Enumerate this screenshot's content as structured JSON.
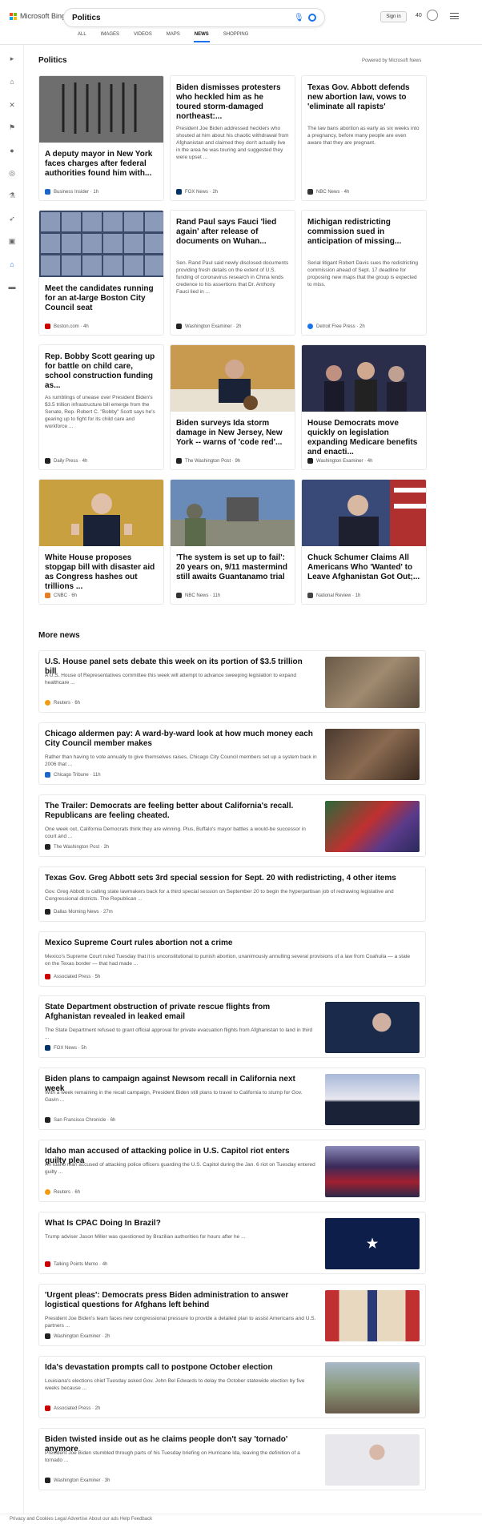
{
  "header": {
    "logo_text": "Microsoft Bing",
    "search_query": "Politics",
    "sign_in": "Sign in",
    "points": "40"
  },
  "tabs": [
    "ALL",
    "IMAGES",
    "VIDEOS",
    "MAPS",
    "NEWS",
    "SHOPPING"
  ],
  "active_tab": "NEWS",
  "sidebar_icons": [
    "expand-icon",
    "home-icon",
    "tools-icon",
    "flag-icon",
    "location-icon",
    "globe-icon",
    "science-icon",
    "rocket-icon",
    "film-icon",
    "bank-icon",
    "card-icon"
  ],
  "section": {
    "title": "Politics",
    "powered": "Powered by Microsoft News"
  },
  "cards": [
    {
      "title": "A deputy mayor in New York faces charges after federal authorities found him with...",
      "source": "Business Insider · 1h",
      "src_color": "#1a66cc",
      "img": "guns"
    },
    {
      "title": "Biden dismisses protesters who heckled him as he toured storm-damaged northeast:...",
      "snippet": "President Joe Biden addressed hecklers who shouted at him about his chaotic withdrawal from Afghanistan and claimed they don't actually live in the area he was touring and suggested they were upset ...",
      "source": "FOX News · 2h",
      "src_color": "#003366"
    },
    {
      "title": "Texas Gov. Abbott defends new abortion law, vows to 'eliminate all rapists'",
      "snippet": "The law bans abortion as early as six weeks into a pregnancy, before many people are even aware that they are pregnant.",
      "source": "NBC News · 4h",
      "src_color": "#333"
    },
    {
      "title": "Meet the candidates running for an at-large Boston City Council seat",
      "source": "Boston.com · 4h",
      "src_color": "#c00",
      "img": "grid"
    },
    {
      "title": "Rand Paul says Fauci 'lied again' after release of documents on Wuhan...",
      "snippet": "Sen. Rand Paul said newly disclosed documents providing fresh details on the extent of U.S. funding of coronavirus research in China lends credence to his assertions that Dr. Anthony Fauci lied in ...",
      "source": "Washington Examiner · 2h",
      "src_color": "#222"
    },
    {
      "title": "Michigan redistricting commission sued in anticipation of missing...",
      "snippet": "Serial litigant Robert Davis sues the redistricting commission ahead of Sept. 17 deadline for proposing new maps that the group is expected to miss.",
      "source": "Detroit Free Press · 2h",
      "src_color": "#1a73e8"
    },
    {
      "title": "Rep. Bobby Scott gearing up for battle on child care, school construction funding as...",
      "snippet": "As rumblings of unease over President Biden's $3.5 trillion infrastructure bill emerge from the Senate, Rep. Robert C. \"Bobby\" Scott says he's gearing up to fight for its child care and workforce ...",
      "source": "Daily Press · 4h",
      "src_color": "#222"
    },
    {
      "title": "Biden surveys Ida storm damage in New Jersey, New York -- warns of 'code red'...",
      "source": "The Washington Post · 9h",
      "src_color": "#222",
      "img": "biden"
    },
    {
      "title": "House Democrats move quickly on legislation expanding Medicare benefits and enacti...",
      "source": "Washington Examiner · 4h",
      "src_color": "#222",
      "img": "dems"
    },
    {
      "title": "White House proposes stopgap bill with disaster aid as Congress hashes out trillions ...",
      "source": "CNBC · 6h",
      "src_color": "#e67e22",
      "img": "biden2"
    },
    {
      "title": "'The system is set up to fail': 20 years on, 9/11 mastermind still awaits Guantanamo trial",
      "source": "NBC News · 11h",
      "src_color": "#333",
      "img": "gitmo"
    },
    {
      "title": "Chuck Schumer Claims All Americans Who 'Wanted' to Leave Afghanistan Got Out;...",
      "source": "National Review · 1h",
      "src_color": "#444",
      "img": "schumer"
    }
  ],
  "more_news_title": "More news",
  "more_news": [
    {
      "title": "U.S. House panel sets debate this week on its portion of $3.5 trillion bill",
      "snippet": "A U.S. House of Representatives committee this week will attempt to advance sweeping legislation to expand healthcare ...",
      "source": "Reuters · 6h",
      "src_color": "#f39c12",
      "thumb": "bridge"
    },
    {
      "title": "Chicago aldermen pay: A ward-by-ward look at how much money each City Council member makes",
      "snippet": "Rather than having to vote annually to give themselves raises, Chicago City Council members set up a system back in 2006 that ...",
      "source": "Chicago Tribune · 11h",
      "src_color": "#1a66cc",
      "thumb": "council"
    },
    {
      "title": "The Trailer: Democrats are feeling better about California's recall. Republicans are feeling cheated.",
      "snippet": "One week out, California Democrats think they are winning. Plus, Buffalo's mayor battles a would-be successor in court and ...",
      "source": "The Washington Post · 2h",
      "src_color": "#222",
      "thumb": "rally"
    },
    {
      "title": "Texas Gov. Greg Abbott sets 3rd special session for Sept. 20 with redistricting, 4 other items",
      "snippet": "Gov. Greg Abbott is calling state lawmakers back for a third special session on September 20 to begin the hyperpartisan job of redrawing legislative and Congressional districts. The Republican ...",
      "source": "Dallas Morning News · 27m",
      "src_color": "#222"
    },
    {
      "title": "Mexico Supreme Court rules abortion not a crime",
      "snippet": "Mexico's Supreme Court ruled Tuesday that it is unconstitutional to punish abortion, unanimously annulling several provisions of a law from Coahuila — a state on the Texas border — that had made ...",
      "source": "Associated Press · 5h",
      "src_color": "#c00"
    },
    {
      "title": "State Department obstruction of private rescue flights from Afghanistan revealed in leaked email",
      "snippet": "The State Department refused to grant official approval for private evacuation flights from Afghanistan to land in third ...",
      "source": "FOX News · 5h",
      "src_color": "#003366",
      "thumb": "blinken"
    },
    {
      "title": "Biden plans to campaign against Newsom recall in California next week",
      "snippet": "With a week remaining in the recall campaign, President Biden still plans to travel to California to stump for Gov. Gavin ...",
      "source": "San Francisco Chronicle · 6h",
      "src_color": "#222",
      "thumb": "biden"
    },
    {
      "title": "Idaho man accused of attacking police in U.S. Capitol riot enters guilty plea",
      "snippet": "An Idaho man accused of attacking police officers guarding the U.S. Capitol during the Jan. 6 riot on Tuesday entered guilty ...",
      "source": "Reuters · 6h",
      "src_color": "#f39c12",
      "thumb": "crowd"
    },
    {
      "title": "What Is CPAC Doing In Brazil?",
      "snippet": "Trump adviser Jason Miller was questioned by Brazilian authorities for hours after he ...",
      "source": "Talking Points Memo · 4h",
      "src_color": "#c00",
      "thumb": "cpac"
    },
    {
      "title": "'Urgent pleas': Democrats press Biden administration to answer logistical questions for Afghans left behind",
      "snippet": "President Joe Biden's team faces new congressional pressure to provide a detailed plan to assist Americans and U.S. partners ...",
      "source": "Washington Examiner · 2h",
      "src_color": "#222",
      "thumb": "flags"
    },
    {
      "title": "Ida's devastation prompts call to postpone October election",
      "snippet": "Louisiana's elections chief Tuesday asked Gov. John Bel Edwards to delay the October statewide election by five weeks because ...",
      "source": "Associated Press · 2h",
      "src_color": "#c00",
      "thumb": "storm"
    },
    {
      "title": "Biden twisted inside out as he claims people don't say 'tornado' anymore",
      "snippet": "President Joe Biden stumbled through parts of his Tuesday briefing on Hurricane Ida, leaving the definition of a tornado ...",
      "source": "Washington Examiner · 3h",
      "src_color": "#222",
      "thumb": "biden3"
    }
  ],
  "footer_text": "Privacy and Cookies  Legal  Advertise  About our ads  Help  Feedback"
}
